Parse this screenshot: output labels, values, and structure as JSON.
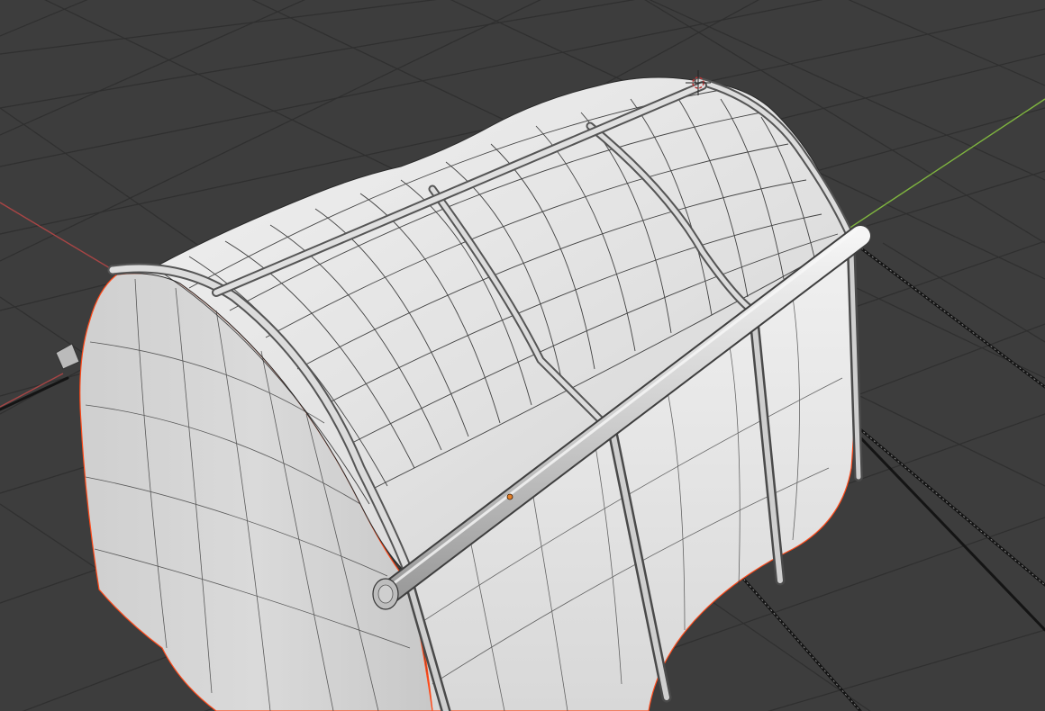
{
  "viewport": {
    "background": "#3d3d3d",
    "grid_color": "#2e2e2e",
    "x_axis_color": "#b84a4a",
    "y_axis_color": "#7fb53f"
  },
  "model": {
    "surface_color": "#e3e3e3",
    "shadow_color": "#c4c4c4",
    "wire_color": "#222222",
    "selected_edge_color": "#ff4a1a",
    "pipe_color": "#d6d6d6"
  },
  "objects": [
    {
      "name": "tent-cover-mesh"
    },
    {
      "name": "tent-frame-arches"
    },
    {
      "name": "ridge-pole"
    },
    {
      "name": "eave-pole"
    },
    {
      "name": "guy-ropes"
    }
  ]
}
